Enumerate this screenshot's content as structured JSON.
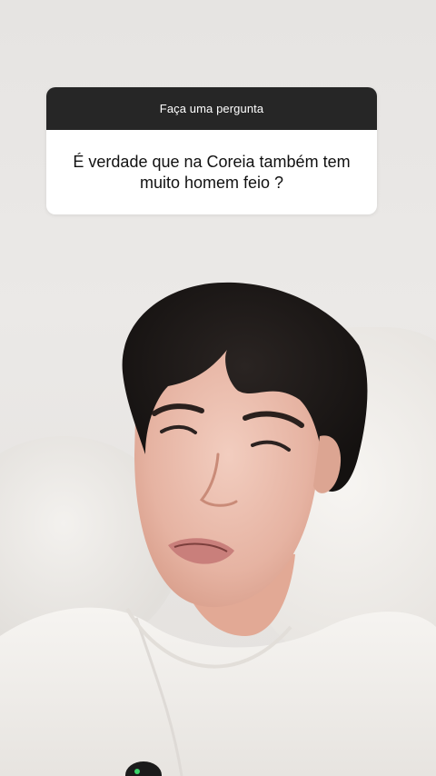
{
  "question_sticker": {
    "header": "Faça uma pergunta",
    "question": "É verdade que na Coreia também tem muito homem feio ?",
    "header_color": "#262626",
    "body_color": "#ffffff"
  },
  "background": {
    "scene": "person-lying-on-pillow",
    "wall_color": "#e9e7e5"
  }
}
